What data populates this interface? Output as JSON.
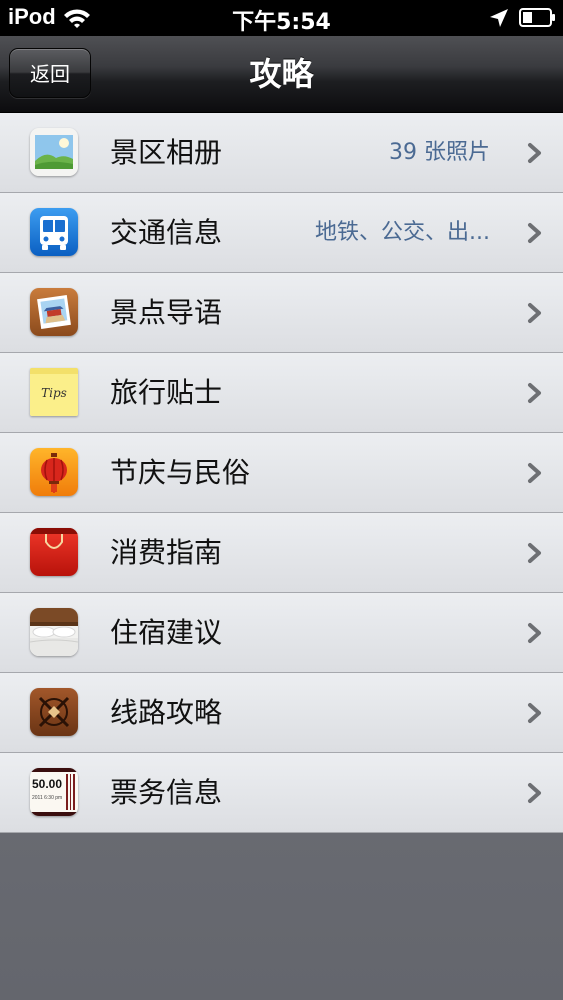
{
  "status_bar": {
    "device": "iPod",
    "time": "下午5:54",
    "wifi_icon": "wifi-icon",
    "location_icon": "location-arrow-icon",
    "battery_icon": "battery-icon"
  },
  "nav": {
    "back_label": "返回",
    "title": "攻略"
  },
  "colors": {
    "detail_text": "#4b6a93",
    "row_bg": "#e4e6e9",
    "nav_bg": "#1d1e21"
  },
  "items": [
    {
      "label": "景区相册",
      "detail": "39 张照片",
      "icon": "photo-album-icon"
    },
    {
      "label": "交通信息",
      "detail": "地铁、公交、出...",
      "icon": "bus-icon"
    },
    {
      "label": "景点导语",
      "detail": "",
      "icon": "temple-photo-icon"
    },
    {
      "label": "旅行贴士",
      "detail": "",
      "icon": "tips-note-icon",
      "icon_text": "Tips"
    },
    {
      "label": "节庆与民俗",
      "detail": "",
      "icon": "lantern-icon"
    },
    {
      "label": "消费指南",
      "detail": "",
      "icon": "shopping-bag-icon"
    },
    {
      "label": "住宿建议",
      "detail": "",
      "icon": "bed-icon"
    },
    {
      "label": "线路攻略",
      "detail": "",
      "icon": "compass-icon"
    },
    {
      "label": "票务信息",
      "detail": "",
      "icon": "ticket-icon",
      "icon_text_1": "50.00",
      "icon_text_2": "2011 6:30 pm"
    }
  ]
}
